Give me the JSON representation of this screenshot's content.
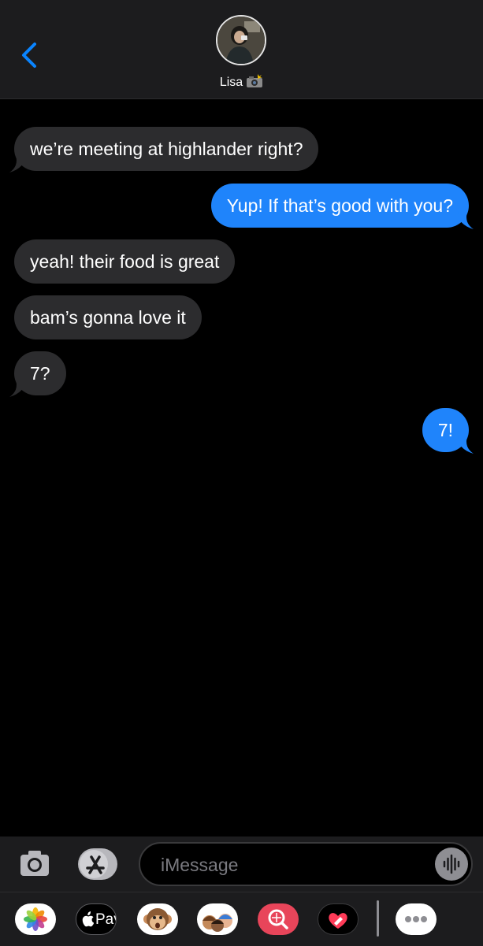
{
  "header": {
    "contact_name": "Lisa",
    "status_emoji_icon": "camera-with-flash-icon"
  },
  "messages": [
    {
      "direction": "incoming",
      "text": "we’re meeting at highlander right?"
    },
    {
      "direction": "outgoing",
      "text": "Yup! If that’s good with you?"
    },
    {
      "direction": "incoming",
      "text": "yeah! their food is great"
    },
    {
      "direction": "incoming",
      "text": "bam’s gonna love it"
    },
    {
      "direction": "incoming",
      "text": "7?"
    },
    {
      "direction": "outgoing",
      "text": "7!"
    }
  ],
  "composer": {
    "placeholder": "iMessage"
  },
  "app_drawer": {
    "apps": [
      {
        "name": "photos-app-icon"
      },
      {
        "name": "apple-pay-app-icon",
        "label": "Pay"
      },
      {
        "name": "animoji-app-icon"
      },
      {
        "name": "memoji-app-icon"
      },
      {
        "name": "images-search-app-icon"
      },
      {
        "name": "digital-touch-app-icon"
      },
      {
        "name": "more-apps-icon"
      }
    ]
  },
  "colors": {
    "outgoing_bubble": "#1f84fb",
    "incoming_bubble": "#2c2c2e",
    "accent": "#0a84ff",
    "background": "#000000"
  }
}
